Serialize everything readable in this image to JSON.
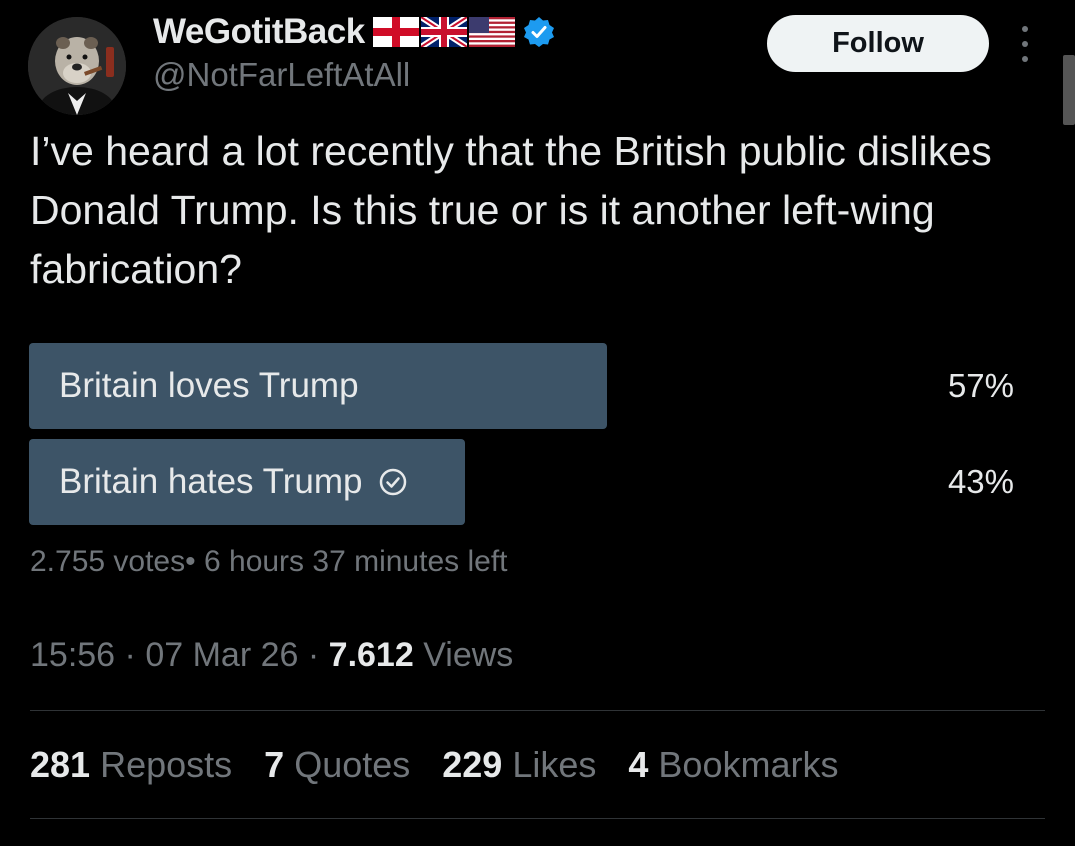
{
  "author": {
    "display_name": "WeGotitBack",
    "handle": "@NotFarLeftAtAll",
    "flags": [
      "england-flag-icon",
      "union-jack-flag-icon",
      "us-flag-icon"
    ],
    "verified_icon": "verified-badge-icon",
    "badge_color": "#1d9bf0"
  },
  "follow_button": {
    "label": "Follow"
  },
  "tweet": {
    "text": "I’ve heard a lot recently that the British public dislikes Donald Trump. Is this true or is it another left-wing fabrication?"
  },
  "poll": {
    "options": [
      {
        "label": "Britain loves Trump",
        "percent_text": "57%",
        "share": 0.57,
        "selected": false
      },
      {
        "label": "Britain hates Trump",
        "percent_text": "43%",
        "share": 0.43,
        "selected": true
      }
    ],
    "bar_color": "#3d5467",
    "votes": "2.755 votes",
    "separator": "•",
    "time_left": "6 hours 37 minutes left"
  },
  "meta": {
    "time": "15:56",
    "date": "07 Mar 26",
    "views_count": "7.612",
    "views_label": "Views"
  },
  "stats": [
    {
      "count": "281",
      "label": "Reposts"
    },
    {
      "count": "7",
      "label": "Quotes"
    },
    {
      "count": "229",
      "label": "Likes"
    },
    {
      "count": "4",
      "label": "Bookmarks"
    }
  ]
}
